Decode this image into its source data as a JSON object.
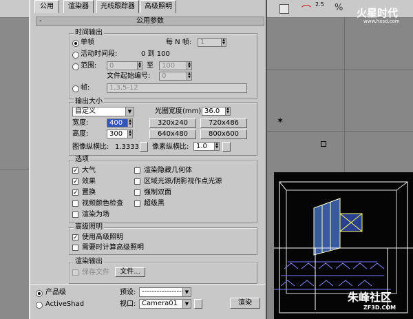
{
  "tabs": [
    "公用",
    "渲染器",
    "光线跟踪器",
    "高级照明"
  ],
  "rollout_title": "公用参数",
  "rollout_toggle": "-",
  "time_output": {
    "label": "时间输出",
    "single": "单帧",
    "every_n_label": "每 N 帧:",
    "every_n_value": "1",
    "active_segment": "活动时间段:",
    "active_range": "0 到 100",
    "range": "范围:",
    "range_from": "0",
    "range_to_label": "至",
    "range_to": "100",
    "file_number_label": "文件起始编号:",
    "file_number": "0",
    "frames": "帧:",
    "frames_value": "1,3,5-12"
  },
  "output_size": {
    "label": "输出大小",
    "preset": "自定义",
    "aperture_label": "光圈宽度(mm):",
    "aperture_value": "36.0",
    "width_label": "宽度:",
    "width_value": "400",
    "height_label": "高度:",
    "height_value": "300",
    "presets": [
      "320x240",
      "720x486",
      "640x480",
      "800x600"
    ],
    "image_aspect_label": "图像纵横比:",
    "image_aspect_value": "1.33333",
    "pixel_aspect_label": "像素纵横比:",
    "pixel_aspect_value": "1.0"
  },
  "options": {
    "label": "选项",
    "items_left": [
      {
        "label": "大气",
        "mark": "✓"
      },
      {
        "label": "效果",
        "mark": "✓"
      },
      {
        "label": "置换",
        "mark": "✓"
      },
      {
        "label": "视频颜色检查",
        "mark": ""
      },
      {
        "label": "渲染为场",
        "mark": ""
      }
    ],
    "items_right": [
      {
        "label": "渲染隐藏几何体",
        "mark": ""
      },
      {
        "label": "区域光源/阴影视作点光源",
        "mark": ""
      },
      {
        "label": "强制双面",
        "mark": ""
      },
      {
        "label": "超级黑",
        "mark": ""
      }
    ]
  },
  "advanced_lighting": {
    "label": "高级照明",
    "use": "使用高级照明",
    "use_mark": "✓",
    "compute": "需要时计算高级照明"
  },
  "render_output": {
    "label": "渲染输出",
    "save_file": "保存文件",
    "files_button": "文件..."
  },
  "bottom": {
    "product": "产品级",
    "activeshade": "ActiveShad",
    "preset_label": "预设:",
    "preset_value": "------------------",
    "viewport_label": "视口:",
    "viewport_value": "Camera01",
    "render_button": "渲染"
  },
  "toolbar": {
    "zoom_value": "2.5"
  },
  "watermarks": {
    "top": "火星时代",
    "top_url": "www.hxsd.com",
    "bottom": "朱峰社区",
    "bottom_url": "ZF3D.COM"
  }
}
